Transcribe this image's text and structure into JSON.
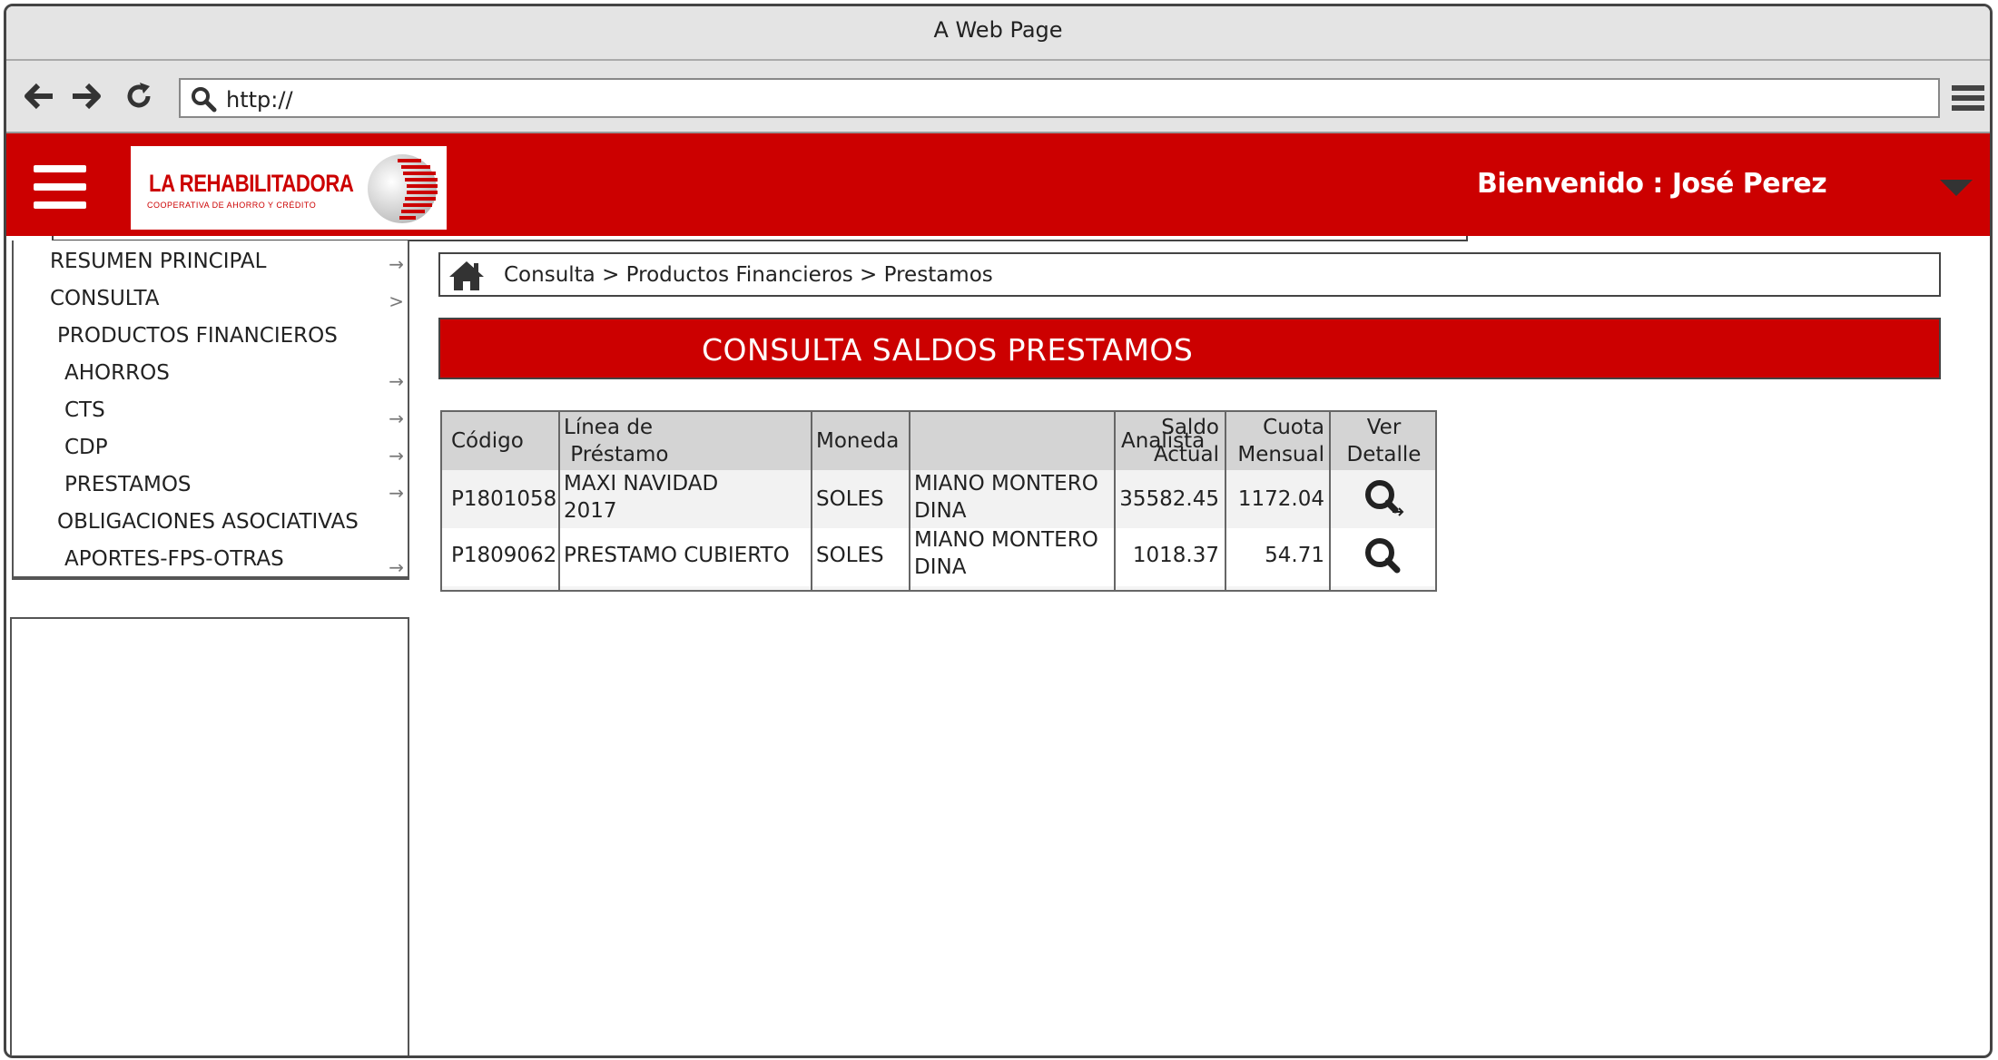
{
  "window": {
    "title": "A Web Page"
  },
  "browser": {
    "url": "http://"
  },
  "header": {
    "logo_brand": "LA REHABILITADORA",
    "logo_subtitle": "COOPERATIVA DE AHORRO Y CRÉDITO",
    "welcome": "Bienvenido : José Perez"
  },
  "sidebar": {
    "items": [
      {
        "label": "RESUMEN PRINCIPAL",
        "arrow": "→"
      },
      {
        "label": "CONSULTA",
        "arrow": ">"
      },
      {
        "label": "PRODUCTOS FINANCIEROS",
        "arrow": ""
      },
      {
        "label": "AHORROS",
        "arrow": "→"
      },
      {
        "label": "CTS",
        "arrow": "→"
      },
      {
        "label": "CDP",
        "arrow": "→"
      },
      {
        "label": "PRESTAMOS",
        "arrow": "→"
      },
      {
        "label": "OBLIGACIONES ASOCIATIVAS",
        "arrow": ""
      },
      {
        "label": "APORTES-FPS-OTRAS",
        "arrow": "→"
      }
    ]
  },
  "breadcrumb": {
    "text": "Consulta > Productos Financieros > Prestamos"
  },
  "page_title": "CONSULTA SALDOS PRESTAMOS",
  "table": {
    "headers": {
      "codigo": "Código",
      "linea": "Línea de\n Préstamo",
      "moneda": "Moneda",
      "analista": "Analista",
      "saldo": "Saldo\nActual",
      "cuota": "Cuota\nMensual",
      "detalle": "Ver\nDetalle"
    },
    "rows": [
      {
        "codigo": "P1801058",
        "linea": "MAXI NAVIDAD\n2017",
        "moneda": "SOLES",
        "analista": "MIANO MONTERO\nDINA",
        "saldo": "35582.45",
        "cuota": "1172.04"
      },
      {
        "codigo": "P1809062",
        "linea": "PRESTAMO CUBIERTO",
        "moneda": "SOLES",
        "analista": "MIANO MONTERO\nDINA",
        "saldo": "1018.37",
        "cuota": "54.71"
      }
    ]
  },
  "colors": {
    "brand_red": "#cc0000",
    "header_gray": "#d4d4d4"
  }
}
